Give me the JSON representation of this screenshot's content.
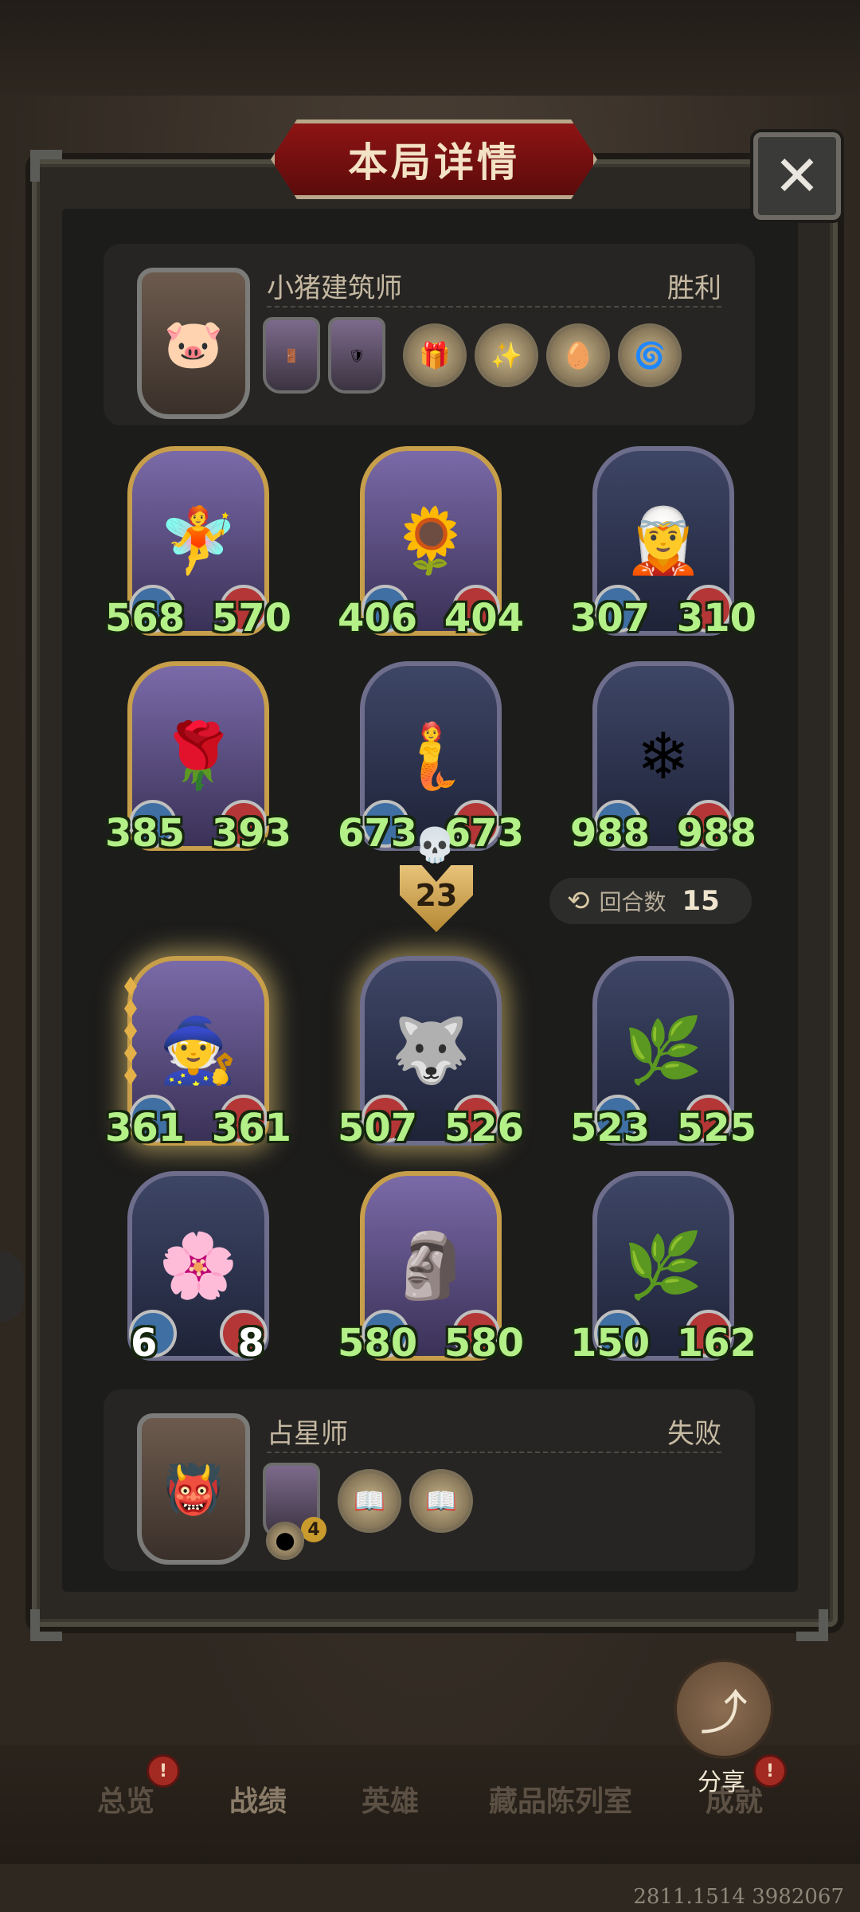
{
  "title": "本局详情",
  "close_label": "✕",
  "top_player": {
    "name": "小猪建筑师",
    "result": "胜利",
    "portrait_icon": "🐷",
    "cards": [
      "🚪",
      "🛡"
    ],
    "relics": [
      "🎁",
      "✨",
      "🥚",
      "🌀"
    ]
  },
  "bottom_player": {
    "name": "占星师",
    "result": "失败",
    "portrait_icon": "👹",
    "card_badge": "4",
    "relics": [
      "📖",
      "📖"
    ],
    "extra_relic": "⬤"
  },
  "top_board": [
    {
      "atk": "568",
      "hp": "570",
      "icon": "🧚"
    },
    {
      "atk": "406",
      "hp": "404",
      "icon": "🌻"
    },
    {
      "atk": "307",
      "hp": "310",
      "icon": "🧝"
    },
    {
      "atk": "385",
      "hp": "393",
      "icon": "🌹"
    },
    {
      "atk": "673",
      "hp": "673",
      "icon": "🧜"
    },
    {
      "atk": "988",
      "hp": "988",
      "icon": "❄"
    }
  ],
  "bottom_board": [
    {
      "atk": "361",
      "hp": "361",
      "icon": "🧙"
    },
    {
      "atk": "507",
      "hp": "526",
      "icon": "🐺"
    },
    {
      "atk": "523",
      "hp": "525",
      "icon": "🌿"
    },
    {
      "atk": "6",
      "hp": "8",
      "icon": "🌸"
    },
    {
      "atk": "580",
      "hp": "580",
      "icon": "🗿"
    },
    {
      "atk": "150",
      "hp": "162",
      "icon": "🌿"
    }
  ],
  "kill_count": "23",
  "skull_icon": "💀",
  "rounds_label": "回合数",
  "rounds_value": "15",
  "rounds_icon": "⟲",
  "nav": [
    "总览",
    "战绩",
    "英雄",
    "藏品陈列室",
    "成就"
  ],
  "nav_badge": "!",
  "share_label": "分享",
  "share_icon": "⤴",
  "footer_id": "2811.1514 3982067"
}
